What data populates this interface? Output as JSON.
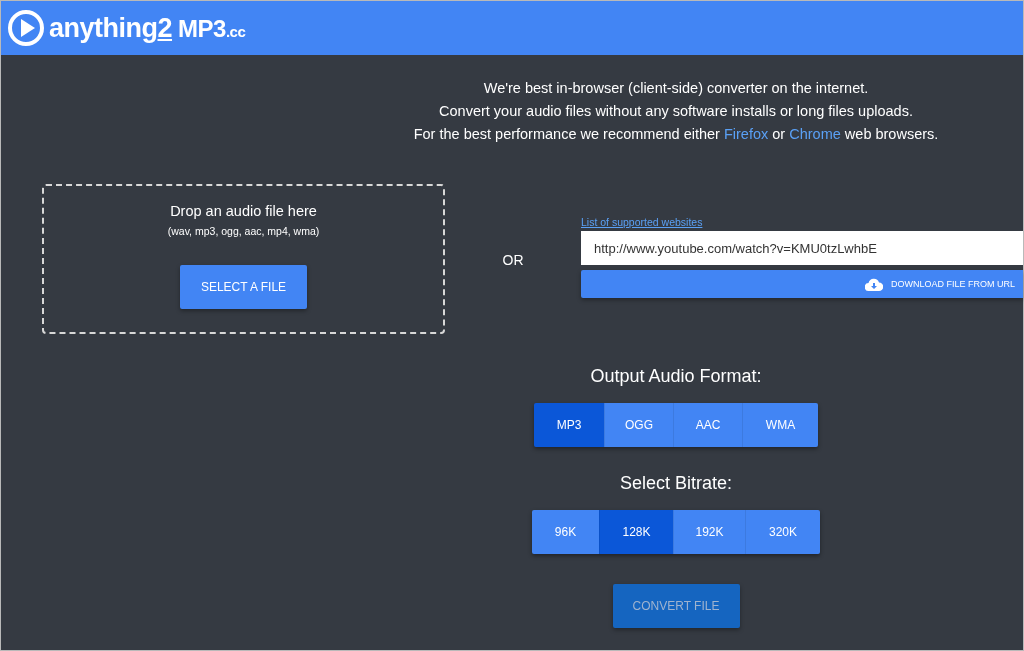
{
  "header": {
    "logo_parts": [
      "anything",
      "2",
      "MP3",
      ".cc"
    ]
  },
  "intro": [
    {
      "segments": [
        {
          "kind": "text",
          "text": "We're best in-browser (client-side) converter on the internet."
        }
      ]
    },
    {
      "segments": [
        {
          "kind": "text",
          "text": "Convert your audio files without any software installs or long files uploads."
        }
      ]
    },
    {
      "segments": [
        {
          "kind": "text",
          "text": "For the best performance we recommend either "
        },
        {
          "kind": "link",
          "text": "Firefox"
        },
        {
          "kind": "text",
          "text": " or "
        },
        {
          "kind": "link",
          "text": "Chrome"
        },
        {
          "kind": "text",
          "text": " web browsers."
        }
      ]
    }
  ],
  "dropzone": {
    "title": "Drop an audio file here",
    "formats": "(wav, mp3, ogg, aac, mp4, wma)",
    "button": "SELECT A FILE"
  },
  "separator": "OR",
  "url_panel": {
    "link": "List of supported websites",
    "value": "http://www.youtube.com/watch?v=KMU0tzLwhbE",
    "button": "DOWNLOAD FILE FROM URL"
  },
  "output_format": {
    "title": "Output Audio Format:",
    "options": [
      {
        "label": "MP3",
        "selected": true
      },
      {
        "label": "OGG",
        "selected": false
      },
      {
        "label": "AAC",
        "selected": false
      },
      {
        "label": "WMA",
        "selected": false
      }
    ]
  },
  "bitrate": {
    "title": "Select Bitrate:",
    "options": [
      {
        "label": "96K",
        "selected": false
      },
      {
        "label": "128K",
        "selected": true
      },
      {
        "label": "192K",
        "selected": false
      },
      {
        "label": "320K",
        "selected": false
      }
    ]
  },
  "convert": {
    "label": "CONVERT FILE",
    "disabled": true
  }
}
